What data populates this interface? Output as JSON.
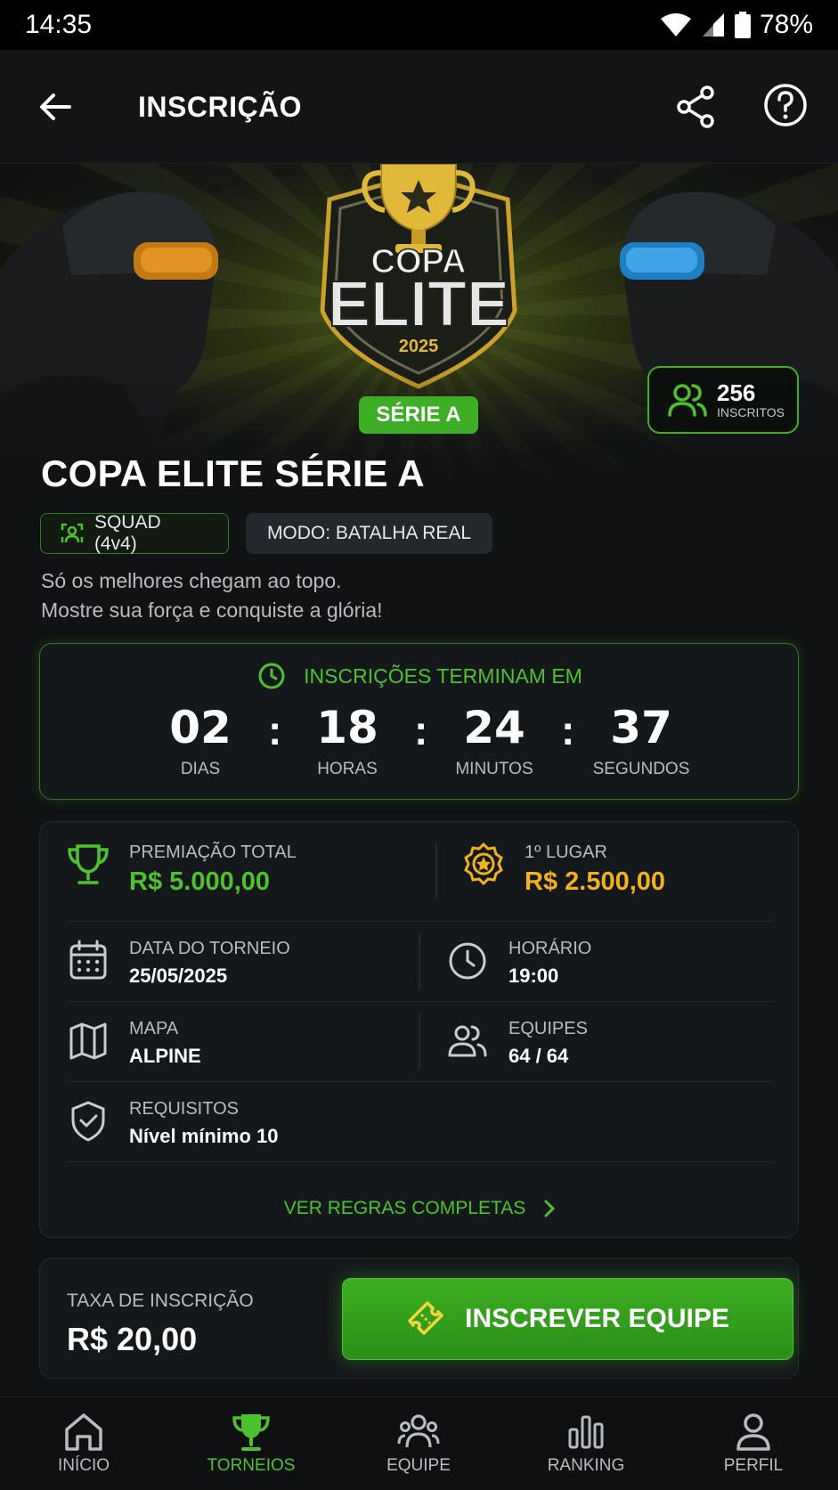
{
  "status_bar": {
    "time": "14:35",
    "battery": "78%"
  },
  "header": {
    "title": "INSCRIÇÃO"
  },
  "hero": {
    "logo": {
      "line1": "COPA",
      "line2": "ELITE",
      "year": "2025"
    },
    "serie_badge": "SÉRIE A",
    "subscribers": {
      "count": "256",
      "label": "INSCRITOS"
    }
  },
  "tournament": {
    "title": "COPA ELITE SÉRIE A",
    "chips": {
      "squad": "SQUAD (4v4)",
      "mode": "MODO: BATALHA REAL"
    },
    "description_line1": "Só os melhores chegam ao topo.",
    "description_line2": "Mostre sua força e conquiste a glória!"
  },
  "countdown": {
    "heading": "INSCRIÇÕES TERMINAM EM",
    "days": {
      "value": "02",
      "label": "DIAS"
    },
    "hours": {
      "value": "18",
      "label": "HORAS"
    },
    "minutes": {
      "value": "24",
      "label": "MINUTOS"
    },
    "seconds": {
      "value": "37",
      "label": "SEGUNDOS"
    },
    "separator": ":"
  },
  "info": {
    "prize_total": {
      "label": "PREMIAÇÃO TOTAL",
      "value": "R$ 5.000,00",
      "color": "#4ec22e"
    },
    "first_place": {
      "label": "1º LUGAR",
      "value": "R$ 2.500,00",
      "color": "#f2b21c"
    },
    "date": {
      "label": "DATA DO TORNEIO",
      "value": "25/05/2025"
    },
    "time": {
      "label": "HORÁRIO",
      "value": "19:00"
    },
    "map": {
      "label": "MAPA",
      "value": "ALPINE"
    },
    "teams": {
      "label": "EQUIPES",
      "value": "64 / 64"
    },
    "requirements": {
      "label": "REQUISITOS",
      "value": "Nível mínimo 10"
    },
    "rules_link": "VER REGRAS COMPLETAS"
  },
  "fee": {
    "label": "TAXA DE INSCRIÇÃO",
    "value": "R$ 20,00",
    "button": "INSCREVER EQUIPE"
  },
  "nav": [
    {
      "label": "INÍCIO",
      "icon": "home-icon"
    },
    {
      "label": "TORNEIOS",
      "icon": "trophy-icon",
      "active": true
    },
    {
      "label": "EQUIPE",
      "icon": "team-icon"
    },
    {
      "label": "RANKING",
      "icon": "ranking-icon"
    },
    {
      "label": "PERFIL",
      "icon": "profile-icon"
    }
  ],
  "colors": {
    "accent": "#4ec22e",
    "gold": "#f2b21c",
    "background": "#101214"
  }
}
